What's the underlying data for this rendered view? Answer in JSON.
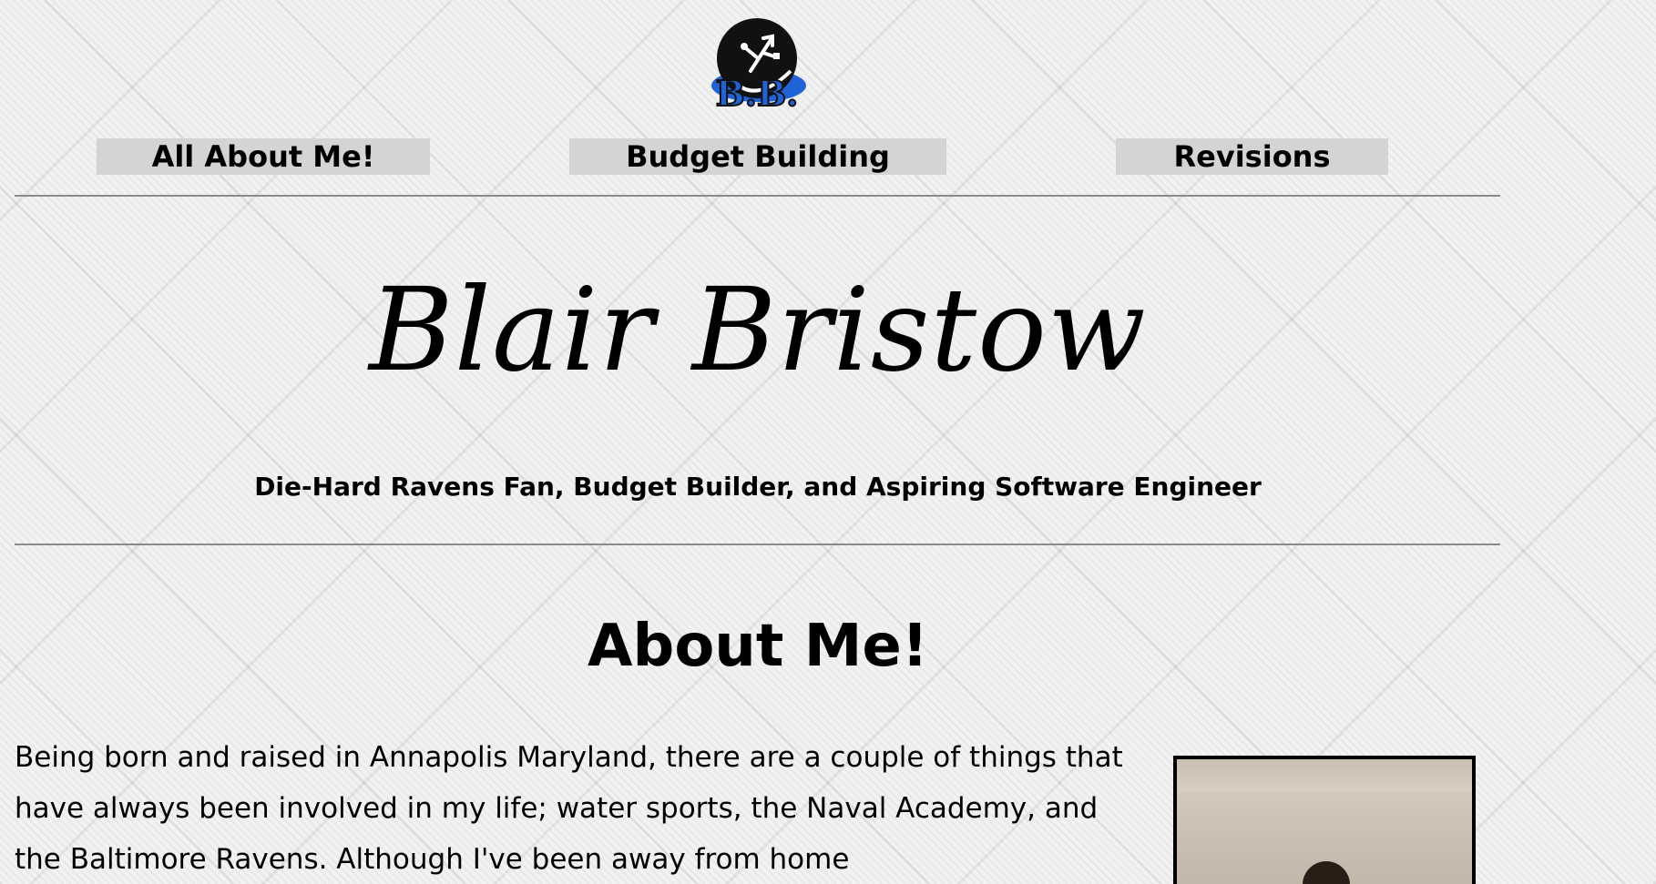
{
  "logo": {
    "text": "B.B.",
    "icon": "usb-icon"
  },
  "nav": {
    "items": [
      {
        "label": "All About Me!"
      },
      {
        "label": "Budget Building"
      },
      {
        "label": "Revisions"
      }
    ]
  },
  "header": {
    "name": "Blair Bristow",
    "tagline": "Die-Hard Ravens Fan, Budget Builder, and Aspiring Software Engineer"
  },
  "about": {
    "heading": "About Me!",
    "text": "Being born and raised in Annapolis Maryland, there are a couple of things that have always been involved in my life; water sports, the Naval Academy, and the Baltimore Ravens. Although I've been away from home"
  },
  "colors": {
    "nav_bg": "#d4d4d4",
    "logo_blue": "#1f63d6",
    "logo_black": "#111111"
  }
}
